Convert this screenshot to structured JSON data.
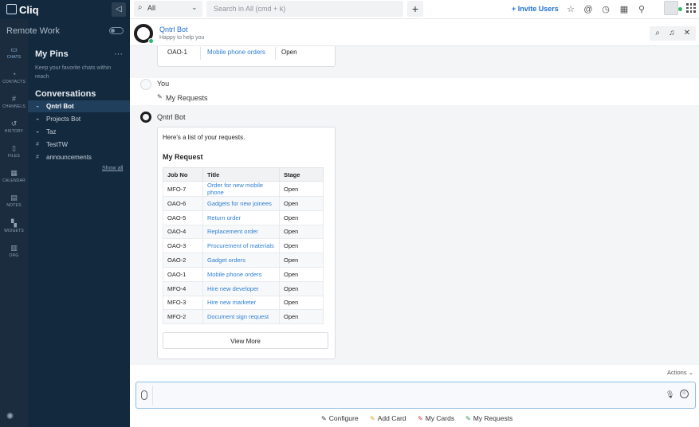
{
  "app": {
    "brand": "Cliq"
  },
  "rail": {
    "items": [
      {
        "label": "CHATS",
        "icon": "chat-icon"
      },
      {
        "label": "CONTACTS",
        "icon": "contacts-icon"
      },
      {
        "label": "CHANNELS",
        "icon": "hash-icon"
      },
      {
        "label": "HISTORY",
        "icon": "history-icon"
      },
      {
        "label": "FILES",
        "icon": "files-icon"
      },
      {
        "label": "CALENDAR",
        "icon": "calendar-icon"
      },
      {
        "label": "NOTES",
        "icon": "notes-icon"
      },
      {
        "label": "WIDGETS",
        "icon": "widgets-icon"
      },
      {
        "label": "ORG",
        "icon": "org-icon"
      }
    ]
  },
  "panel": {
    "workspace": "Remote Work",
    "pins_heading": "My Pins",
    "pins_more": "···",
    "pins_desc": "Keep your favorite chats within reach",
    "conversations_heading": "Conversations",
    "conversations": [
      {
        "label": "Qntrl Bot",
        "icon": "bot-icon",
        "active": true
      },
      {
        "label": "Projects Bot",
        "icon": "bot-icon"
      },
      {
        "label": "Taz",
        "icon": "bot-icon"
      },
      {
        "label": "TestTW",
        "icon": "hash-icon"
      },
      {
        "label": "announcements",
        "icon": "hash-icon"
      }
    ],
    "show_all": "Show all"
  },
  "topbar": {
    "scope": "All",
    "search_placeholder": "Search in All (cmd + k)",
    "add": "+",
    "invite": "+ Invite Users"
  },
  "chat_header": {
    "name": "Qntrl Bot",
    "status": "Happy to help you"
  },
  "messages": {
    "prev_row": {
      "job": "OAO-1",
      "title": "Mobile phone orders",
      "stage": "Open"
    },
    "you_name": "You",
    "you_message": "My Requests",
    "bot_name": "Qntrl Bot",
    "bot_intro": "Here's a list of your requests.",
    "card_heading": "My Request",
    "columns": [
      "Job No",
      "Title",
      "Stage"
    ],
    "rows": [
      {
        "job": "MFO-7",
        "title": "Order for new mobile phone",
        "stage": "Open"
      },
      {
        "job": "OAO-6",
        "title": "Gadgets for new joinees",
        "stage": "Open"
      },
      {
        "job": "OAO-5",
        "title": "Return order",
        "stage": "Open"
      },
      {
        "job": "OAO-4",
        "title": "Replacement order",
        "stage": "Open"
      },
      {
        "job": "OAO-3",
        "title": "Procurement of materials",
        "stage": "Open"
      },
      {
        "job": "OAO-2",
        "title": "Gadget orders",
        "stage": "Open"
      },
      {
        "job": "OAO-1",
        "title": "Mobile phone orders",
        "stage": "Open"
      },
      {
        "job": "MFO-4",
        "title": "Hire new developer",
        "stage": "Open"
      },
      {
        "job": "MFO-3",
        "title": "Hire new marketer",
        "stage": "Open"
      },
      {
        "job": "MFO-2",
        "title": "Document sign request",
        "stage": "Open"
      }
    ],
    "view_more": "View More"
  },
  "composer": {
    "actions": "Actions",
    "quick_actions": [
      "Configure",
      "Add Card",
      "My Cards",
      "My Requests"
    ]
  },
  "colors": {
    "sidebar": "#13293d",
    "rail": "#1a2c3e",
    "accent": "#1f6fd3",
    "link": "#2f7fd3"
  }
}
